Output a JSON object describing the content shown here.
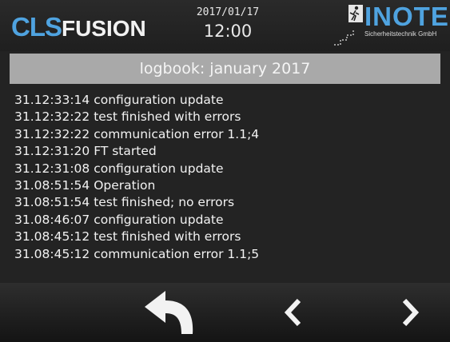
{
  "header": {
    "brand_part1": "CLS",
    "brand_part2": "FUSION",
    "date": "2017/01/17",
    "time": "12:00",
    "logo_name": "INOTEC",
    "logo_tagline": "Sicherheitstechnik GmbH"
  },
  "title": "logbook: january 2017",
  "log_entries": [
    "31.12:33:14 configuration update",
    "31.12:32:22 test finished with errors",
    "31.12:32:22 communication error 1.1;4",
    "31.12:31:20 FT started",
    "31.12:31:08 configuration update",
    "31.08:51:54 Operation",
    "31.08:51:54 test finished; no errors",
    "31.08:46:07 configuration update",
    "31.08:45:12 test finished with errors",
    "31.08:45:12 communication error 1.1;5"
  ],
  "nav": {
    "back_icon": "return-arrow-icon",
    "prev_icon": "chevron-left-icon",
    "next_icon": "chevron-right-icon"
  },
  "colors": {
    "brand_blue": "#4fa3e0",
    "background": "#232323",
    "title_bar": "#a9a9a9",
    "text": "#f2f2f2"
  }
}
